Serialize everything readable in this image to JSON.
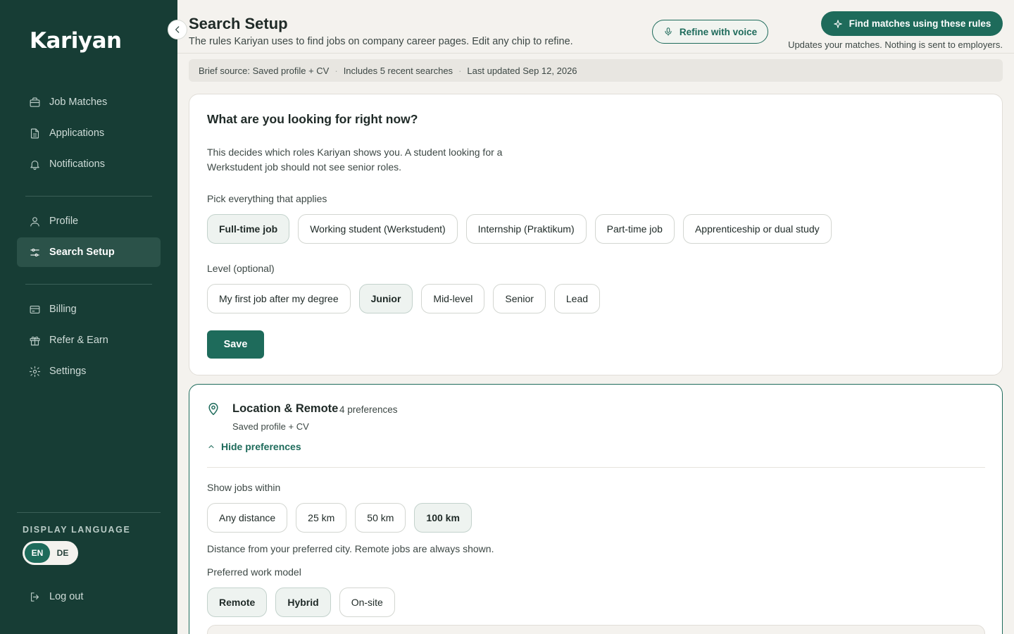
{
  "app": {
    "name": "Kariyan"
  },
  "sidebar": {
    "nav_main": [
      {
        "label": "Job Matches",
        "icon": "briefcase-icon"
      },
      {
        "label": "Applications",
        "icon": "document-icon"
      },
      {
        "label": "Notifications",
        "icon": "bell-icon"
      }
    ],
    "nav_account": [
      {
        "label": "Profile",
        "icon": "user-icon"
      },
      {
        "label": "Search Setup",
        "icon": "sliders-icon",
        "active": true
      }
    ],
    "nav_other": [
      {
        "label": "Billing",
        "icon": "credit-card-icon"
      },
      {
        "label": "Refer & Earn",
        "icon": "gift-icon"
      },
      {
        "label": "Settings",
        "icon": "gear-icon"
      }
    ],
    "language": {
      "label": "DISPLAY LANGUAGE",
      "options": [
        "EN",
        "DE"
      ],
      "selected": "EN"
    },
    "logout": {
      "label": "Log out",
      "icon": "logout-icon"
    }
  },
  "header": {
    "title": "Search Setup",
    "subtitle": "The rules Kariyan uses to find jobs on company career pages. Edit any chip to refine.",
    "voice_button": "Refine with voice",
    "primary_button": "Find matches using these rules",
    "primary_note": "Updates your matches. Nothing is sent to employers."
  },
  "brief": {
    "items": [
      "Brief source: Saved profile + CV",
      "Includes 5 recent searches",
      "Last updated Sep 12, 2026"
    ],
    "separator": "·"
  },
  "looking_for": {
    "title": "What are you looking for right now?",
    "description": "This decides which roles Kariyan shows you. A student looking for a Werkstudent job should not see senior roles.",
    "job_types_label": "Pick everything that applies",
    "job_types": [
      {
        "label": "Full-time job",
        "selected": true
      },
      {
        "label": "Working student (Werkstudent)",
        "selected": false
      },
      {
        "label": "Internship (Praktikum)",
        "selected": false
      },
      {
        "label": "Part-time job",
        "selected": false
      },
      {
        "label": "Apprenticeship or dual study",
        "selected": false
      }
    ],
    "level_label": "Level (optional)",
    "levels": [
      {
        "label": "My first job after my degree",
        "selected": false
      },
      {
        "label": "Junior",
        "selected": true
      },
      {
        "label": "Mid-level",
        "selected": false
      },
      {
        "label": "Senior",
        "selected": false
      },
      {
        "label": "Lead",
        "selected": false
      }
    ],
    "save_label": "Save"
  },
  "location": {
    "title": "Location & Remote",
    "count": "4 preferences",
    "source": "Saved profile + CV",
    "toggle_label": "Hide preferences",
    "distance_label": "Show jobs within",
    "distances": [
      {
        "label": "Any distance",
        "selected": false
      },
      {
        "label": "25 km",
        "selected": false
      },
      {
        "label": "50 km",
        "selected": false
      },
      {
        "label": "100 km",
        "selected": true
      }
    ],
    "distance_help": "Distance from your preferred city. Remote jobs are always shown.",
    "work_model_label": "Preferred work model",
    "work_models": [
      {
        "label": "Remote",
        "selected": true
      },
      {
        "label": "Hybrid",
        "selected": true
      },
      {
        "label": "On-site",
        "selected": false
      }
    ]
  },
  "colors": {
    "sidebar_bg": "#173d35",
    "accent": "#1e6b5b",
    "page_bg": "#f4f2ee"
  }
}
